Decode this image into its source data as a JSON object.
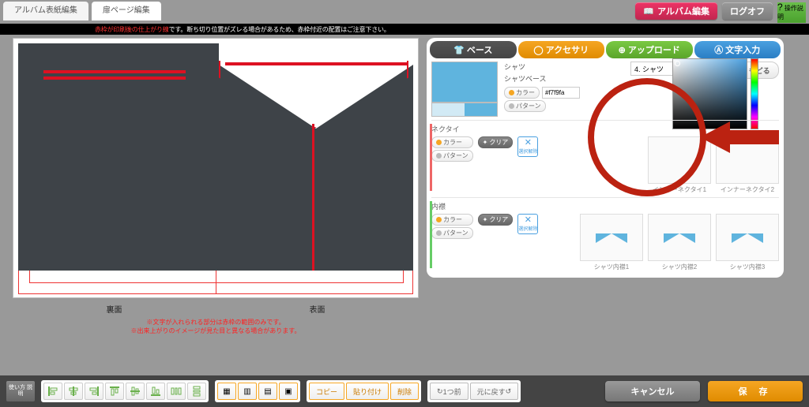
{
  "tabs": {
    "cover": "アルバム表紙編集",
    "door": "扉ページ編集"
  },
  "top_actions": {
    "album_edit": "アルバム編集",
    "logoff": "ログオフ",
    "help": "操作説明"
  },
  "notice": {
    "red": "赤枠が印刷後の仕上がり線",
    "rest": "です。断ち切り位置がズレる場合があるため、赤枠付近の配置はご注意下さい。"
  },
  "preview": {
    "back": "裏面",
    "front": "表面",
    "warn1": "※文字が入れられる部分は赤枠の範囲のみです。",
    "warn2": "※出来上がりのイメージが見た目と異なる場合があります。"
  },
  "panel_tabs": {
    "base": "ベース",
    "accessory": "アクセサリ",
    "upload": "アップロード",
    "text": "文字入力",
    "back": "もどる"
  },
  "shirt": {
    "label": "シャツ",
    "base_label": "シャツベース",
    "select": "4. シャツ"
  },
  "color_hex": "#f7f9fa",
  "swatch_colors": {
    "main": "#5fb4de",
    "split_a": "#d2eaf5",
    "split_b": "#5fb4de"
  },
  "mini": {
    "color": "カラー",
    "pattern": "パターン",
    "clear": "クリア"
  },
  "necktie": {
    "title": "ネクタイ",
    "deselect": "選択解除",
    "items": [
      "インナーネクタイ1",
      "インナーネクタイ2"
    ]
  },
  "collar": {
    "title": "内襟",
    "deselect": "選択解除",
    "items": [
      "シャツ内襟1",
      "シャツ内襟2",
      "シャツ内襟3"
    ]
  },
  "footer": {
    "usage": "使い方\n説明",
    "copy": "コピー",
    "paste": "貼り付け",
    "delete": "削除",
    "undo": "1つ前",
    "redo": "元に戻す",
    "cancel": "キャンセル",
    "save": "保 存"
  }
}
